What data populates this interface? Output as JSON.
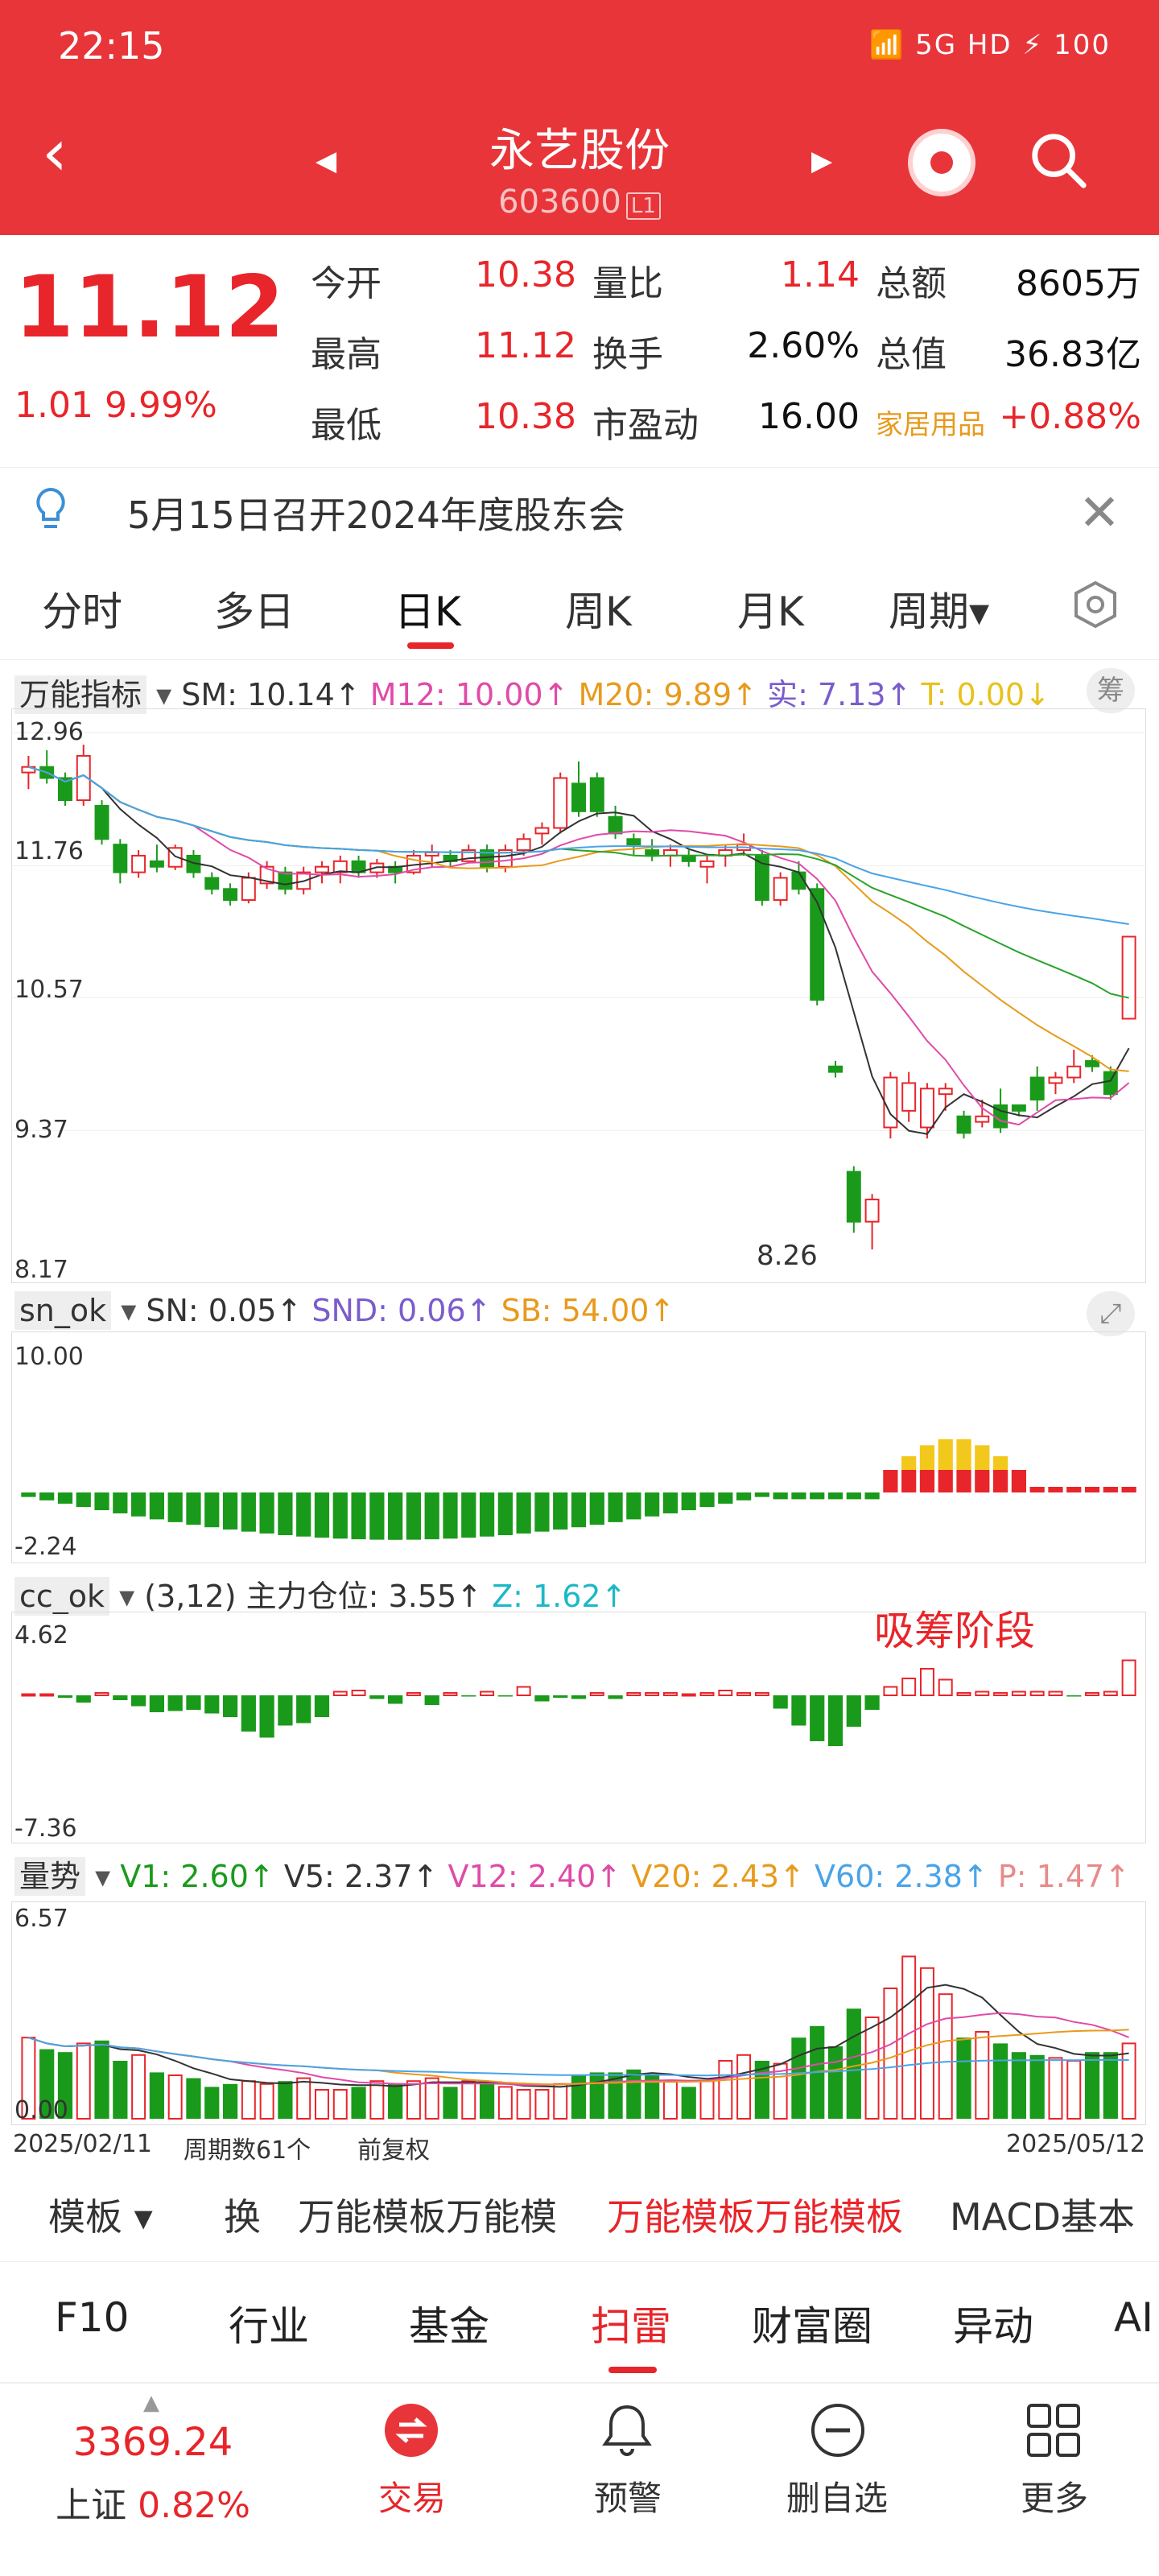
{
  "status": {
    "time": "22:15",
    "icons": "📶 5G HD ⚡ 100"
  },
  "header": {
    "name": "永艺股份",
    "code": "603600",
    "tag": "L1"
  },
  "quote": {
    "price": "11.12",
    "change": "1.01",
    "pct": "9.99%",
    "rows": [
      [
        {
          "l": "今开",
          "v": "10.38",
          "c": "red"
        },
        {
          "l": "量比",
          "v": "1.14",
          "c": "red"
        },
        {
          "l": "总额",
          "v": "8605万",
          "c": "blk"
        }
      ],
      [
        {
          "l": "最高",
          "v": "11.12",
          "c": "red"
        },
        {
          "l": "换手",
          "v": "2.60%",
          "c": "blk"
        },
        {
          "l": "总值",
          "v": "36.83亿",
          "c": "blk"
        }
      ],
      [
        {
          "l": "最低",
          "v": "10.38",
          "c": "red"
        },
        {
          "l": "市盈动",
          "v": "16.00",
          "c": "blk"
        },
        {
          "l": "家居用品",
          "v": "+0.88%",
          "c": "red"
        }
      ]
    ]
  },
  "notice": {
    "text": "5月15日召开2024年度股东会"
  },
  "tabs": [
    "分时",
    "多日",
    "日K",
    "周K",
    "月K",
    "周期▾"
  ],
  "colors": {
    "up": "#e8252a",
    "down": "#1a9a1a",
    "ma5": "#333333",
    "ma10": "#e04aa8",
    "ma20": "#e89a1c",
    "ma30": "#2aa32a",
    "ma60": "#4aa3e8"
  },
  "panel1": {
    "indicator": "万能指标",
    "sm": "SM: 10.14↑",
    "m12": "M12: 10.00↑",
    "m20": "M20: 9.89↑",
    "shi": "实: 7.13↑",
    "t": "T: 0.00↓",
    "chou": "筹",
    "ylabels": [
      "12.96",
      "11.76",
      "10.57",
      "9.37",
      "8.17"
    ],
    "low_label": "8.26"
  },
  "panel2": {
    "indicator": "sn_ok",
    "sn": "SN: 0.05↑",
    "snd": "SND: 0.06↑",
    "sb": "SB: 54.00↑",
    "ylabels": [
      "10.00",
      "-2.24"
    ]
  },
  "panel3": {
    "indicator": "cc_ok",
    "param": "(3,12)",
    "main": "主力仓位: 3.55↑",
    "z": "Z: 1.62↑",
    "ylabels": [
      "4.62",
      "-7.36"
    ],
    "annotation": "吸筹阶段"
  },
  "panel4": {
    "indicator": "量势",
    "v1": "V1: 2.60↑",
    "v5": "V5: 2.37↑",
    "v12": "V12: 2.40↑",
    "v20": "V20: 2.43↑",
    "v60": "V60: 2.38↑",
    "p": "P: 1.47↑",
    "ylabels": [
      "6.57",
      "0.00"
    ],
    "date_start": "2025/02/11",
    "periods": "周期数61个",
    "adjust": "前复权",
    "date_end": "2025/05/12"
  },
  "templates": {
    "label": "模板 ▾",
    "items": [
      "换",
      "万能模板万能模",
      "万能模板万能模板",
      "MACD基本"
    ]
  },
  "bottomtabs": [
    "F10",
    "行业",
    "基金",
    "扫雷",
    "财富圈",
    "异动",
    "AI"
  ],
  "tabbar": {
    "index_value": "3369.24",
    "index_name": "上证",
    "index_pct": "0.82%",
    "trade": "交易",
    "alert": "预警",
    "delete": "删自选",
    "more": "更多"
  },
  "chart_data": {
    "type": "candlestick",
    "count": 61,
    "candles": [
      [
        12.6,
        12.75,
        12.45,
        12.65
      ],
      [
        12.65,
        12.8,
        12.5,
        12.55
      ],
      [
        12.55,
        12.6,
        12.3,
        12.35
      ],
      [
        12.35,
        12.85,
        12.3,
        12.75
      ],
      [
        12.3,
        12.35,
        11.95,
        12.0
      ],
      [
        11.95,
        12.0,
        11.6,
        11.7
      ],
      [
        11.7,
        11.9,
        11.65,
        11.85
      ],
      [
        11.8,
        11.95,
        11.7,
        11.75
      ],
      [
        11.75,
        11.95,
        11.72,
        11.92
      ],
      [
        11.85,
        11.9,
        11.65,
        11.7
      ],
      [
        11.65,
        11.7,
        11.5,
        11.55
      ],
      [
        11.55,
        11.6,
        11.4,
        11.45
      ],
      [
        11.45,
        11.7,
        11.42,
        11.65
      ],
      [
        11.6,
        11.8,
        11.55,
        11.75
      ],
      [
        11.7,
        11.75,
        11.5,
        11.55
      ],
      [
        11.55,
        11.75,
        11.5,
        11.7
      ],
      [
        11.7,
        11.8,
        11.6,
        11.75
      ],
      [
        11.7,
        11.85,
        11.6,
        11.8
      ],
      [
        11.8,
        11.85,
        11.65,
        11.7
      ],
      [
        11.7,
        11.82,
        11.65,
        11.78
      ],
      [
        11.75,
        11.8,
        11.6,
        11.7
      ],
      [
        11.7,
        11.9,
        11.68,
        11.85
      ],
      [
        11.85,
        11.95,
        11.75,
        11.88
      ],
      [
        11.85,
        11.9,
        11.75,
        11.8
      ],
      [
        11.8,
        11.95,
        11.78,
        11.9
      ],
      [
        11.9,
        11.95,
        11.7,
        11.75
      ],
      [
        11.75,
        11.95,
        11.7,
        11.9
      ],
      [
        11.9,
        12.05,
        11.85,
        12.0
      ],
      [
        12.05,
        12.15,
        11.95,
        12.1
      ],
      [
        12.1,
        12.6,
        12.05,
        12.55
      ],
      [
        12.5,
        12.7,
        12.2,
        12.25
      ],
      [
        12.55,
        12.6,
        12.2,
        12.25
      ],
      [
        12.2,
        12.3,
        12.0,
        12.05
      ],
      [
        12.0,
        12.05,
        11.85,
        11.95
      ],
      [
        11.9,
        12.0,
        11.8,
        11.85
      ],
      [
        11.85,
        11.95,
        11.75,
        11.9
      ],
      [
        11.85,
        11.9,
        11.75,
        11.8
      ],
      [
        11.75,
        11.85,
        11.6,
        11.8
      ],
      [
        11.85,
        11.95,
        11.75,
        11.9
      ],
      [
        11.9,
        12.05,
        11.85,
        11.95
      ],
      [
        11.85,
        11.9,
        11.4,
        11.45
      ],
      [
        11.45,
        11.7,
        11.4,
        11.65
      ],
      [
        11.7,
        11.8,
        11.5,
        11.55
      ],
      [
        11.55,
        11.6,
        10.5,
        10.55
      ],
      [
        9.95,
        10.0,
        9.85,
        9.9
      ],
      [
        9.0,
        9.05,
        8.45,
        8.55
      ],
      [
        8.55,
        8.8,
        8.3,
        8.75
      ],
      [
        9.4,
        9.9,
        9.3,
        9.85
      ],
      [
        9.55,
        9.9,
        9.45,
        9.8
      ],
      [
        9.4,
        9.8,
        9.3,
        9.75
      ],
      [
        9.7,
        9.8,
        9.55,
        9.75
      ],
      [
        9.5,
        9.55,
        9.3,
        9.35
      ],
      [
        9.45,
        9.65,
        9.4,
        9.5
      ],
      [
        9.6,
        9.75,
        9.35,
        9.4
      ],
      [
        9.6,
        9.6,
        9.5,
        9.55
      ],
      [
        9.85,
        9.95,
        9.55,
        9.65
      ],
      [
        9.8,
        9.9,
        9.7,
        9.85
      ],
      [
        9.85,
        10.1,
        9.8,
        9.95
      ],
      [
        10.0,
        10.05,
        9.9,
        9.95
      ],
      [
        9.9,
        9.95,
        9.65,
        9.7
      ],
      [
        10.38,
        11.12,
        10.38,
        11.12
      ]
    ]
  }
}
